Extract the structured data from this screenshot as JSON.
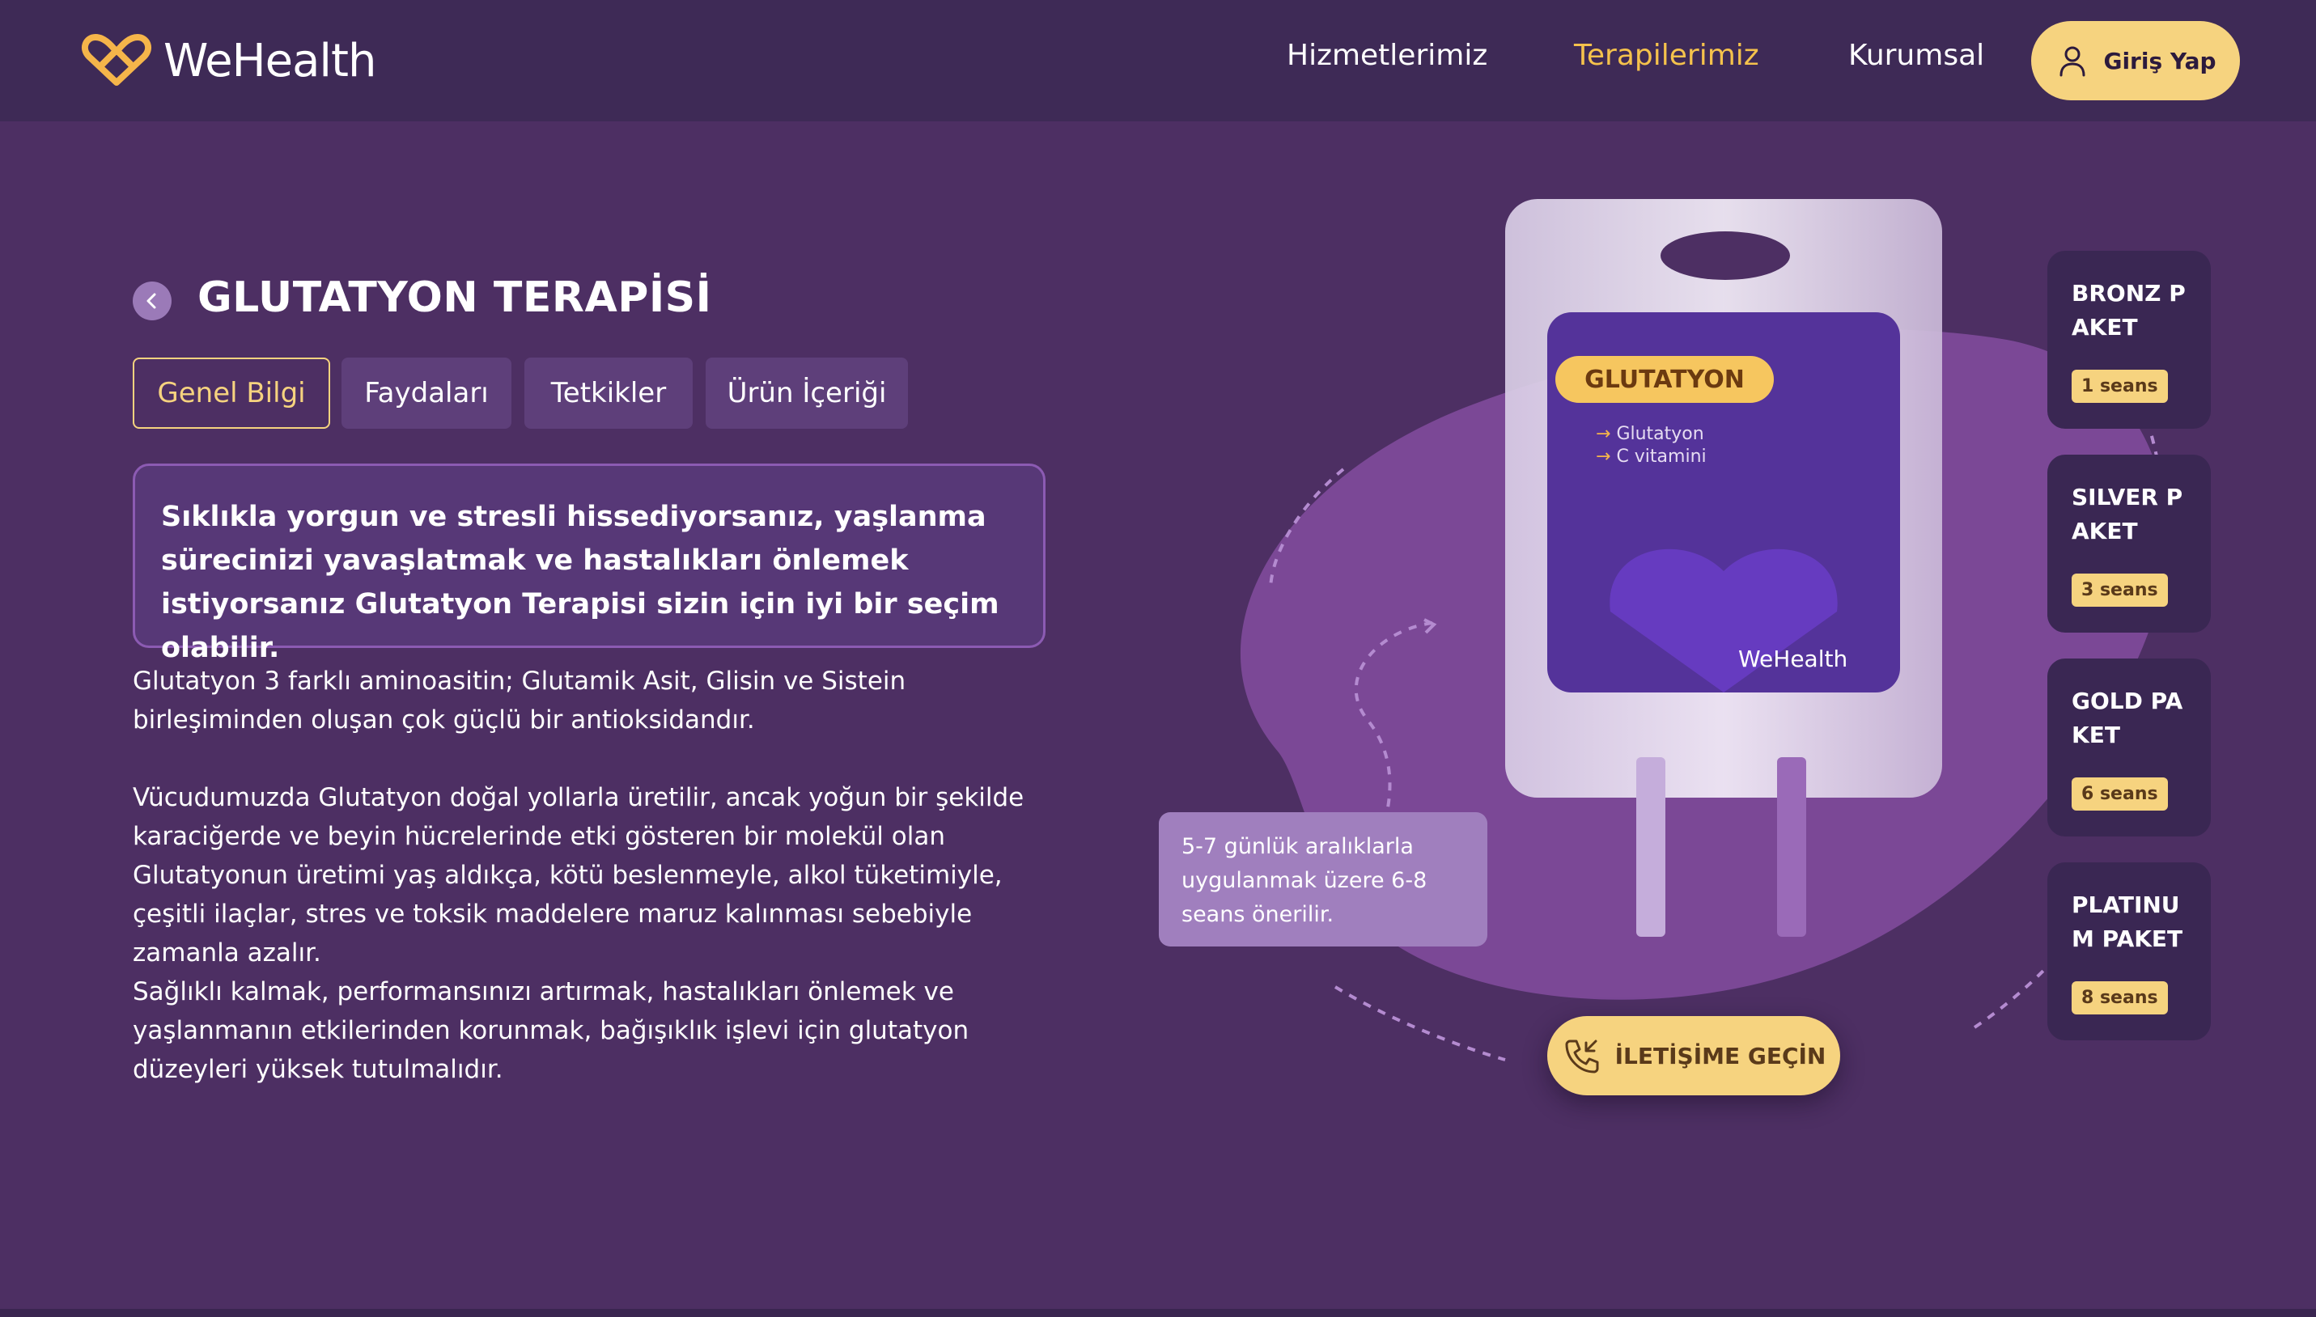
{
  "brand": {
    "name": "WeHealth",
    "accent": "#f6d37f",
    "nav_active": "#f5c24c",
    "bg": "#4d2f63",
    "nav_bg": "#3e2a56"
  },
  "nav": {
    "items": [
      {
        "label": "Hizmetlerimiz",
        "active": false
      },
      {
        "label": "Terapilerimiz",
        "active": true
      },
      {
        "label": "Kurumsal",
        "active": false
      }
    ],
    "login_label": "Giriş Yap",
    "login_icon": "user-icon"
  },
  "main": {
    "back_icon": "chevron-left-icon",
    "title": "GLUTATYON TERAPİSİ",
    "tabs": [
      {
        "label": "Genel Bilgi",
        "active": true
      },
      {
        "label": "Faydaları",
        "active": false
      },
      {
        "label": "Tetkikler",
        "active": false
      },
      {
        "label": "Ürün İçeriği",
        "active": false
      }
    ],
    "highlight": "Sıklıkla yorgun ve stresli hissediyorsanız, yaşlanma sürecinizi yavaşlatmak ve hastalıkları önlemek istiyorsanız Glutatyon Terapisi sizin için iyi bir seçim olabilir.",
    "paragraphs": [
      "Glutatyon 3 farklı aminoasitin; Glutamik Asit, Glisin ve Sistein birleşiminden oluşan çok güçlü bir antioksidandır.",
      "Vücudumuzda Glutatyon doğal yollarla üretilir, ancak yoğun bir şekilde karaciğerde ve beyin hücrelerinde etki gösteren bir molekül olan Glutatyonun üretimi yaş aldıkça, kötü beslenmeyle, alkol tüketimiyle, çeşitli ilaçlar, stres ve toksik maddelere maruz kalınması sebebiyle zamanla azalır.",
      "Sağlıklı kalmak, performansınızı artırmak, hastalıkları önlemek ve yaşlanmanın etkilerinden korunmak, bağışıklık işlevi için glutatyon düzeyleri yüksek tutulmalıdır."
    ]
  },
  "product": {
    "label": "GLUTATYON",
    "ingredients": [
      "Glutatyon",
      "C vitamini"
    ],
    "brand": "WeHealth",
    "info": "5-7 günlük aralıklarla uygulanmak üzere 6-8 seans önerilir.",
    "contact_label": "İLETİŞİME GEÇİN",
    "contact_icon": "phone-incoming-icon"
  },
  "packages": [
    {
      "name": "BRONZ PAKET",
      "sessions": "1 seans"
    },
    {
      "name": "SILVER PAKET",
      "sessions": "3 seans"
    },
    {
      "name": "GOLD PAKET",
      "sessions": "6 seans"
    },
    {
      "name": "PLATINUM PAKET",
      "sessions": "8 seans"
    }
  ]
}
